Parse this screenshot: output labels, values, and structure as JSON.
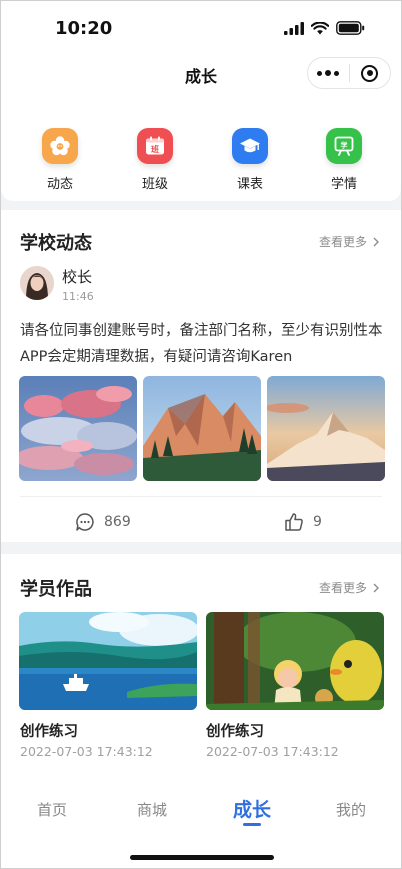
{
  "status_bar": {
    "time": "10:20"
  },
  "nav": {
    "title": "成长"
  },
  "quick_nav": [
    {
      "label": "动态",
      "icon": "flower-icon",
      "color": "#f7a64b"
    },
    {
      "label": "班级",
      "icon": "calendar-icon",
      "color": "#ef4f52"
    },
    {
      "label": "课表",
      "icon": "graduation-cap-icon",
      "color": "#2f7bf0"
    },
    {
      "label": "学情",
      "icon": "chart-board-icon",
      "color": "#36c24a"
    }
  ],
  "school_news": {
    "title": "学校动态",
    "more": "查看更多",
    "post": {
      "author": "校长",
      "time": "11:46",
      "text": "请各位同事创建账号时，备注部门名称，至少有识别性本APP会定期清理数据，有疑问请咨询Karen",
      "images": [
        "pink-clouds-image",
        "mountain-sunrise-image",
        "mountain-peak-image"
      ],
      "comments": "869",
      "likes": "9"
    }
  },
  "student_works": {
    "title": "学员作品",
    "more": "查看更多",
    "items": [
      {
        "title": "创作练习",
        "date": "2022-07-03 17:43:12",
        "image": "lake-boat-illustration"
      },
      {
        "title": "创作练习",
        "date": "2022-07-03 17:43:12",
        "image": "cartoon-forest-illustration"
      }
    ]
  },
  "tabbar": {
    "items": [
      {
        "label": "首页"
      },
      {
        "label": "商城"
      },
      {
        "label": "成长"
      },
      {
        "label": "我的"
      }
    ],
    "active": "成长",
    "accent": "#2f6fe0"
  }
}
